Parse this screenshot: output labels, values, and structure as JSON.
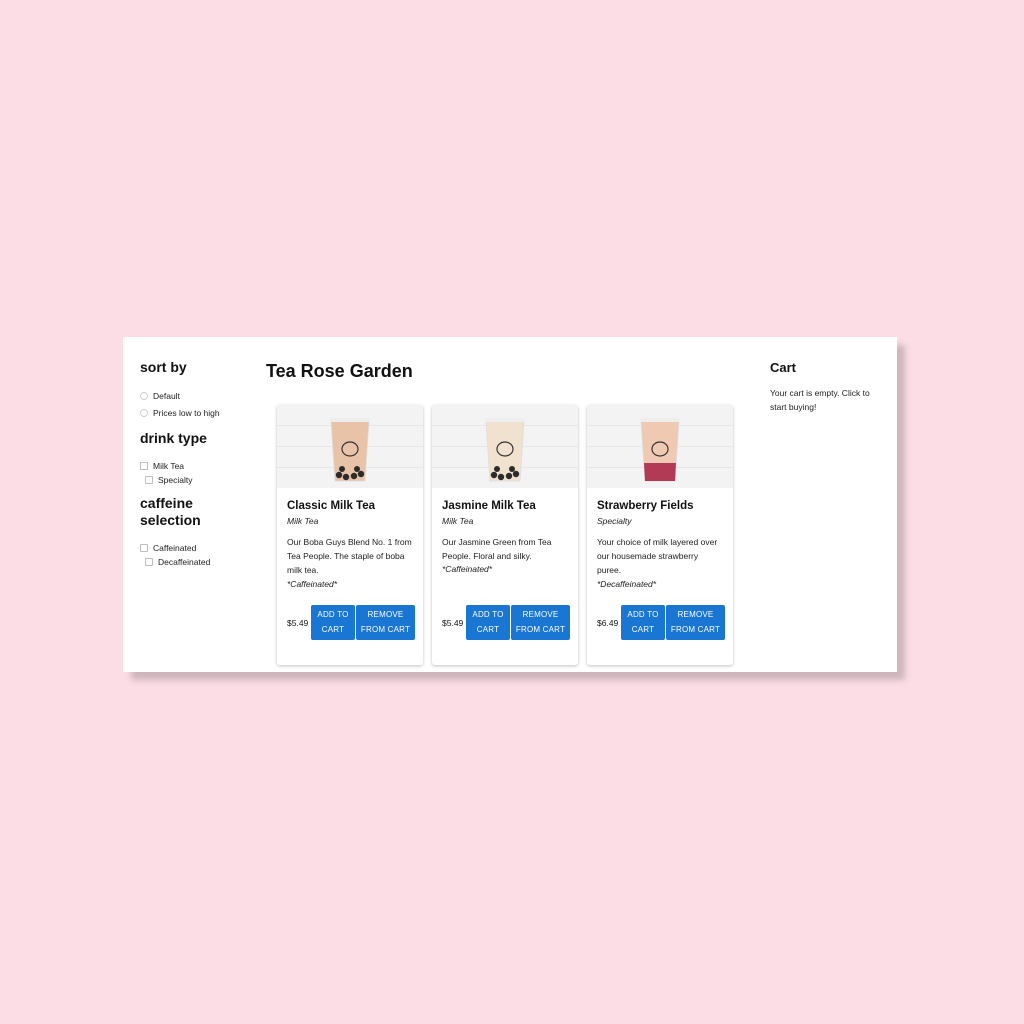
{
  "sidebar": {
    "sort_heading": "sort by",
    "sort_options": [
      "Default",
      "Prices low to high"
    ],
    "drink_heading": "drink type",
    "drink_options": [
      "Milk Tea",
      "Specialty"
    ],
    "caffeine_heading": "caffeine selection",
    "caffeine_options": [
      "Caffeinated",
      "Decaffeinated"
    ]
  },
  "store": {
    "title": "Tea Rose Garden"
  },
  "products": [
    {
      "name": "Classic Milk Tea",
      "type": "Milk Tea",
      "description": "Our Boba Guys Blend No. 1 from Tea People. The staple of boba milk tea.",
      "caffeine": "*Caffeinated*",
      "price": "$5.49",
      "add_label": "ADD TO CART",
      "remove_label": "REMOVE FROM CART",
      "liquid_color": "#e8c3a8"
    },
    {
      "name": "Jasmine Milk Tea",
      "type": "Milk Tea",
      "description": "Our Jasmine Green from Tea People. Floral and silky.",
      "caffeine": "*Caffeinated*",
      "price": "$5.49",
      "add_label": "ADD TO CART",
      "remove_label": "REMOVE FROM CART",
      "liquid_color": "#f1e2cf"
    },
    {
      "name": "Strawberry Fields",
      "type": "Specialty",
      "description": "Your choice of milk layered over our housemade strawberry puree.",
      "caffeine": "*Decaffeinated*",
      "price": "$6.49",
      "add_label": "ADD TO CART",
      "remove_label": "REMOVE FROM CART",
      "liquid_color": "#efc9b2"
    }
  ],
  "cart": {
    "title": "Cart",
    "empty_message": "Your cart is empty. Click to start buying!"
  },
  "colors": {
    "background": "#fcdde5",
    "button": "#1976d2"
  }
}
